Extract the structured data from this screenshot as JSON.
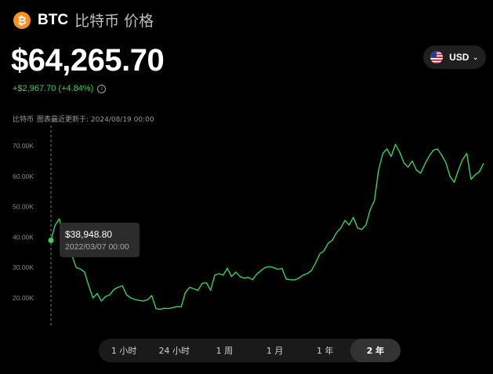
{
  "header": {
    "symbol": "BTC",
    "name": "比特币 价格",
    "icon": "bitcoin-icon"
  },
  "price": "$64,265.70",
  "change": "+$2,967.70 (+4.84%)",
  "currency": {
    "label": "USD",
    "icon": "us-flag-icon"
  },
  "updated": {
    "asset": "比特币",
    "text": "图表最近更新于: 2024/08/19 00:00"
  },
  "tooltip": {
    "value": "$38,948.80",
    "date": "2022/03/07 00:00"
  },
  "range": {
    "options": [
      "1 小时",
      "24 小时",
      "1 周",
      "1 月",
      "1 年",
      "2 年"
    ],
    "active": "2 年"
  },
  "colors": {
    "line": "#3ad15a",
    "accent": "#f7931a"
  },
  "chart_data": {
    "type": "line",
    "ylim": [
      10000,
      75000
    ],
    "yticks": [
      "70.00K",
      "60.00K",
      "50.00K",
      "40.00K",
      "30.00K",
      "20.00K"
    ],
    "ytick_values": [
      70000,
      60000,
      50000,
      40000,
      30000,
      20000
    ],
    "x_start": "2022-03-07",
    "x_end": "2024-08-19",
    "hover_index": 0,
    "values": [
      38948,
      44000,
      46000,
      40000,
      36000,
      34000,
      30000,
      29500,
      28500,
      24000,
      20000,
      21500,
      19000,
      20500,
      21000,
      22800,
      23500,
      24000,
      21000,
      20000,
      19500,
      19200,
      19000,
      19400,
      20800,
      16500,
      16300,
      16600,
      16500,
      16800,
      17200,
      17000,
      21800,
      23500,
      23000,
      22500,
      24800,
      25000,
      22500,
      27500,
      28000,
      27500,
      29800,
      27000,
      28500,
      27000,
      26500,
      26800,
      26000,
      27800,
      29000,
      30000,
      30300,
      30000,
      29400,
      29700,
      26200,
      26000,
      25900,
      26500,
      27500,
      28000,
      29000,
      31500,
      34500,
      35500,
      38000,
      39000,
      41500,
      43000,
      45500,
      44000,
      46500,
      43000,
      42500,
      44000,
      49000,
      52000,
      62000,
      67500,
      69000,
      66500,
      70500,
      68000,
      64500,
      63000,
      65000,
      62000,
      61000,
      64000,
      66500,
      68500,
      69000,
      67000,
      64500,
      60000,
      58000,
      62000,
      65500,
      67500,
      59000,
      60500,
      61500,
      64265
    ]
  }
}
